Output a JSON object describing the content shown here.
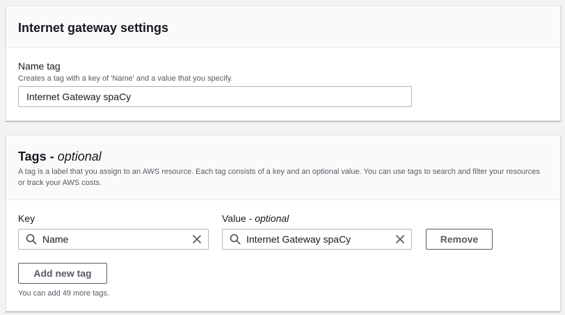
{
  "gateway_settings": {
    "title": "Internet gateway settings",
    "name_tag_label": "Name tag",
    "name_tag_description": "Creates a tag with a key of 'Name' and a value that you specify.",
    "name_tag_value": "Internet Gateway spaCy"
  },
  "tags": {
    "title": "Tags -",
    "title_optional": "optional",
    "description": "A tag is a label that you assign to an AWS resource. Each tag consists of a key and an optional value. You can use tags to search and filter your resources or track your AWS costs.",
    "key_label": "Key",
    "value_label": "Value -",
    "value_label_optional": "optional",
    "rows": [
      {
        "key": "Name",
        "value": "Internet Gateway spaCy"
      }
    ],
    "remove_label": "Remove",
    "add_label": "Add new tag",
    "remaining_text": "You can add 49 more tags."
  },
  "icons": {
    "search": "search-icon",
    "clear": "close-icon"
  }
}
